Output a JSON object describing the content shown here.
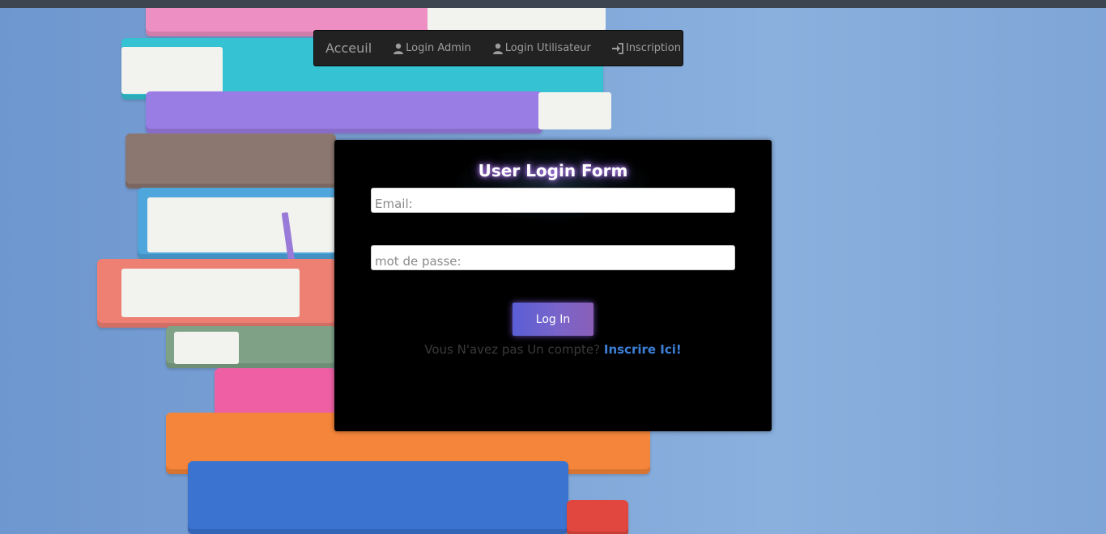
{
  "navbar": {
    "brand": "Acceuil",
    "items": [
      {
        "label": "Login Admin",
        "icon": "user-icon"
      },
      {
        "label": "Login Utilisateur",
        "icon": "user-icon"
      },
      {
        "label": "Inscription",
        "icon": "log-in-icon"
      }
    ]
  },
  "login_form": {
    "title": "User Login Form",
    "email_placeholder": "Email:",
    "password_placeholder": "mot de passe:",
    "submit_label": "Log In",
    "signup_prompt": "Vous N'avez pas Un compte?",
    "signup_link": "Inscrire Ici!"
  },
  "colors": {
    "background": "#7fa6d8",
    "navbar": "#222222",
    "card": "#000000",
    "button_start": "#5a5fd6",
    "button_end": "#8a5fb8",
    "link": "#3c7fd6"
  }
}
